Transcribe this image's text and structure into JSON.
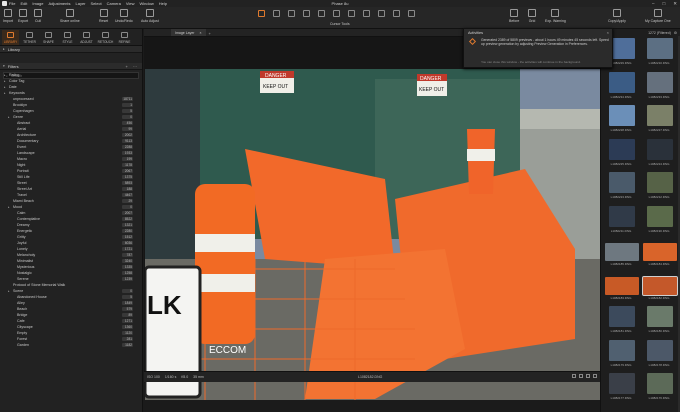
{
  "menubar": {
    "items": [
      "File",
      "Edit",
      "Image",
      "Adjustments",
      "Layer",
      "Select",
      "Camera",
      "View",
      "Window",
      "Help"
    ],
    "title": "Phase 8u"
  },
  "toolbar": {
    "left": [
      "Import",
      "Export",
      "Cull",
      "Share online"
    ],
    "middle": [
      "Reset",
      "Undo/Redo",
      "Auto Adjust"
    ],
    "cursor_tools_label": "Cursor Tools",
    "right": [
      "Before",
      "Grid",
      "Exp. Warning"
    ],
    "copy_apply": "Copy/Apply",
    "workspace": "My Capture One"
  },
  "tooltabs": [
    "LIBRARY",
    "TETHER",
    "SHAPE",
    "STYLE",
    "ADJUST",
    "RETOUCH",
    "REFINE"
  ],
  "library": {
    "title": "Library"
  },
  "filters": {
    "title": "Filters",
    "search_placeholder": "Search",
    "rows": [
      {
        "label": "Rating",
        "indent": 1,
        "tri": true,
        "count": ""
      },
      {
        "label": "Color Tag",
        "indent": 1,
        "tri": true,
        "count": ""
      },
      {
        "label": "Date",
        "indent": 1,
        "tri": true,
        "count": ""
      },
      {
        "label": "Keywords",
        "indent": 1,
        "tri": true,
        "count": ""
      },
      {
        "label": "unprocessed",
        "indent": 2,
        "tri": false,
        "count": "18711"
      },
      {
        "label": "Brooklyn",
        "indent": 2,
        "tri": false,
        "count": "1"
      },
      {
        "label": "Copenhagen",
        "indent": 2,
        "tri": false,
        "count": "5"
      },
      {
        "label": "Genre",
        "indent": 2,
        "tri": true,
        "count": "0"
      },
      {
        "label": "Abstract",
        "indent": 3,
        "tri": false,
        "count": "456"
      },
      {
        "label": "Aerial",
        "indent": 3,
        "tri": false,
        "count": "99"
      },
      {
        "label": "Architecture",
        "indent": 3,
        "tri": false,
        "count": "2002"
      },
      {
        "label": "Documentary",
        "indent": 3,
        "tri": false,
        "count": "9113"
      },
      {
        "label": "Event",
        "indent": 3,
        "tri": false,
        "count": "2288"
      },
      {
        "label": "Landscape",
        "indent": 3,
        "tri": false,
        "count": "1933"
      },
      {
        "label": "Macro",
        "indent": 3,
        "tri": false,
        "count": "199"
      },
      {
        "label": "Night",
        "indent": 3,
        "tri": false,
        "count": "1178"
      },
      {
        "label": "Portrait",
        "indent": 3,
        "tri": false,
        "count": "2067"
      },
      {
        "label": "Still Life",
        "indent": 3,
        "tri": false,
        "count": "1375"
      },
      {
        "label": "Street",
        "indent": 3,
        "tri": false,
        "count": "5893"
      },
      {
        "label": "Street Art",
        "indent": 3,
        "tri": false,
        "count": "188"
      },
      {
        "label": "Travel",
        "indent": 3,
        "tri": false,
        "count": "4467"
      },
      {
        "label": "Miami Beach",
        "indent": 2,
        "tri": false,
        "count": "29"
      },
      {
        "label": "Mood",
        "indent": 2,
        "tri": true,
        "count": "0"
      },
      {
        "label": "Calm",
        "indent": 3,
        "tri": false,
        "count": "2007"
      },
      {
        "label": "Contemplative",
        "indent": 3,
        "tri": false,
        "count": "8522"
      },
      {
        "label": "Dreamy",
        "indent": 3,
        "tri": false,
        "count": "1321"
      },
      {
        "label": "Energetic",
        "indent": 3,
        "tri": false,
        "count": "2280"
      },
      {
        "label": "Gritty",
        "indent": 3,
        "tri": false,
        "count": "1512"
      },
      {
        "label": "Joyful",
        "indent": 3,
        "tri": false,
        "count": "6036"
      },
      {
        "label": "Lonely",
        "indent": 3,
        "tri": false,
        "count": "1721"
      },
      {
        "label": "Melancholy",
        "indent": 3,
        "tri": false,
        "count": "787"
      },
      {
        "label": "Minimalist",
        "indent": 3,
        "tri": false,
        "count": "3240"
      },
      {
        "label": "Mysterious",
        "indent": 3,
        "tri": false,
        "count": "1335"
      },
      {
        "label": "Nostalgic",
        "indent": 3,
        "tri": false,
        "count": "1258"
      },
      {
        "label": "Serene",
        "indent": 3,
        "tri": false,
        "count": "1239"
      },
      {
        "label": "Protocol of Stone Memorial Walk",
        "indent": 2,
        "tri": false,
        "count": ""
      },
      {
        "label": "Scene",
        "indent": 2,
        "tri": true,
        "count": "0"
      },
      {
        "label": "Abandoned House",
        "indent": 3,
        "tri": false,
        "count": "5"
      },
      {
        "label": "Alley",
        "indent": 3,
        "tri": false,
        "count": "1849"
      },
      {
        "label": "Beach",
        "indent": 3,
        "tri": false,
        "count": "579"
      },
      {
        "label": "Bridge",
        "indent": 3,
        "tri": false,
        "count": "89"
      },
      {
        "label": "Cafe",
        "indent": 3,
        "tri": false,
        "count": "1271"
      },
      {
        "label": "Cityscape",
        "indent": 3,
        "tri": false,
        "count": "1360"
      },
      {
        "label": "Empty",
        "indent": 3,
        "tri": false,
        "count": "1120"
      },
      {
        "label": "Forest",
        "indent": 3,
        "tri": false,
        "count": "281"
      },
      {
        "label": "Garden",
        "indent": 3,
        "tri": false,
        "count": "1182"
      }
    ]
  },
  "viewer": {
    "tab_label": "Image Layer",
    "tab_close": "×",
    "tab_add": "+",
    "meta": [
      "ISO 100",
      "1/160 s",
      "f/8.0",
      "35 mm"
    ],
    "filename": "L1082182.DNG"
  },
  "browser": {
    "header": "1272 (Filtered)",
    "thumbs": [
      {
        "cap": "L1082229.DNG",
        "color": "#4f6e9a",
        "land": false
      },
      {
        "cap": "L1082210.DNG",
        "color": "#5c6f83",
        "land": false
      },
      {
        "cap": "L1082234.DNG",
        "color": "#3b5c85",
        "land": false
      },
      {
        "cap": "L1082233.DNG",
        "color": "#65707d",
        "land": false
      },
      {
        "cap": "L1082228.DNG",
        "color": "#6b8fb8",
        "land": false
      },
      {
        "cap": "L1082227.DNG",
        "color": "#7b8068",
        "land": false
      },
      {
        "cap": "L1082225.DNG",
        "color": "#2c3b55",
        "land": false
      },
      {
        "cap": "L1082224.DNG",
        "color": "#2a313a",
        "land": false
      },
      {
        "cap": "L1082223.DNG",
        "color": "#4a5a6a",
        "land": false
      },
      {
        "cap": "L1082212.DNG",
        "color": "#566247",
        "land": false
      },
      {
        "cap": "L1082211.DNG",
        "color": "#303a48",
        "land": false
      },
      {
        "cap": "L1082190.DNG",
        "color": "#5a6a4a",
        "land": false
      },
      {
        "cap": "L1082185.DNG",
        "color": "#6e7880",
        "land": true
      },
      {
        "cap": "L1082184.DNG",
        "color": "#d9642a",
        "land": true
      },
      {
        "cap": "L1082183.DNG",
        "color": "#c85a26",
        "land": true
      },
      {
        "cap": "L1082182.DNG",
        "color": "#c4582a",
        "land": true
      },
      {
        "cap": "L1082181.DNG",
        "color": "#3c4a5c",
        "land": false
      },
      {
        "cap": "L1082180.DNG",
        "color": "#6a7a6a",
        "land": false
      },
      {
        "cap": "L1082179.DNG",
        "color": "#506070",
        "land": false
      },
      {
        "cap": "L1082178.DNG",
        "color": "#4c5868",
        "land": false
      },
      {
        "cap": "L1082177.DNG",
        "color": "#3a3f48",
        "land": false
      },
      {
        "cap": "L1082176.DNG",
        "color": "#5c6a58",
        "land": false
      }
    ]
  },
  "activities": {
    "title": "Activities",
    "close": "×",
    "message": "Generated 2389 of 5809 previews - about 1 hours 49 minutes 45 seconds left.",
    "message2": "Speed up preview generation by adjusting Preview Generation in Preferences.",
    "sub": "You can close this window - the activities will continue in the background."
  },
  "photo": {
    "sign1_top": "DANGER",
    "sign1_bottom": "KEEP OUT",
    "sign2_top": "DANGER",
    "sign2_bottom": "KEEP OUT",
    "barrel_text": "ECCOM",
    "arrow_sign": "LK"
  },
  "colors": {
    "accent": "#e07a2e",
    "barrier_orange": "#f2692a",
    "fence_green": "#2f5a4e"
  }
}
